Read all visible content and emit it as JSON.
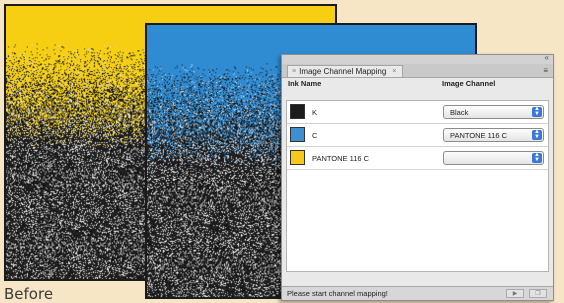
{
  "caption": "Before",
  "panel": {
    "tab_title": "Image Channel Mapping",
    "tab_close": "×",
    "tab_grip": "≡",
    "menu_icon": "≡",
    "collapse": "«",
    "columns": {
      "ink": "Ink Name",
      "channel": "Image Channel"
    },
    "rows": [
      {
        "ink": "K",
        "channel": "Black",
        "color": "#1c1c1c"
      },
      {
        "ink": "C",
        "channel": "PANTONE 116 C",
        "color": "#3d8fd0"
      },
      {
        "ink": "PANTONE 116 C",
        "channel": "",
        "color": "#f6c817"
      }
    ],
    "status": "Please start channel mapping!",
    "play_icon": "▶",
    "new_icon": "❐"
  },
  "colors": {
    "yellow": "#f6cf12",
    "blue": "#2f8cd3",
    "background": "#f7e6c6"
  }
}
